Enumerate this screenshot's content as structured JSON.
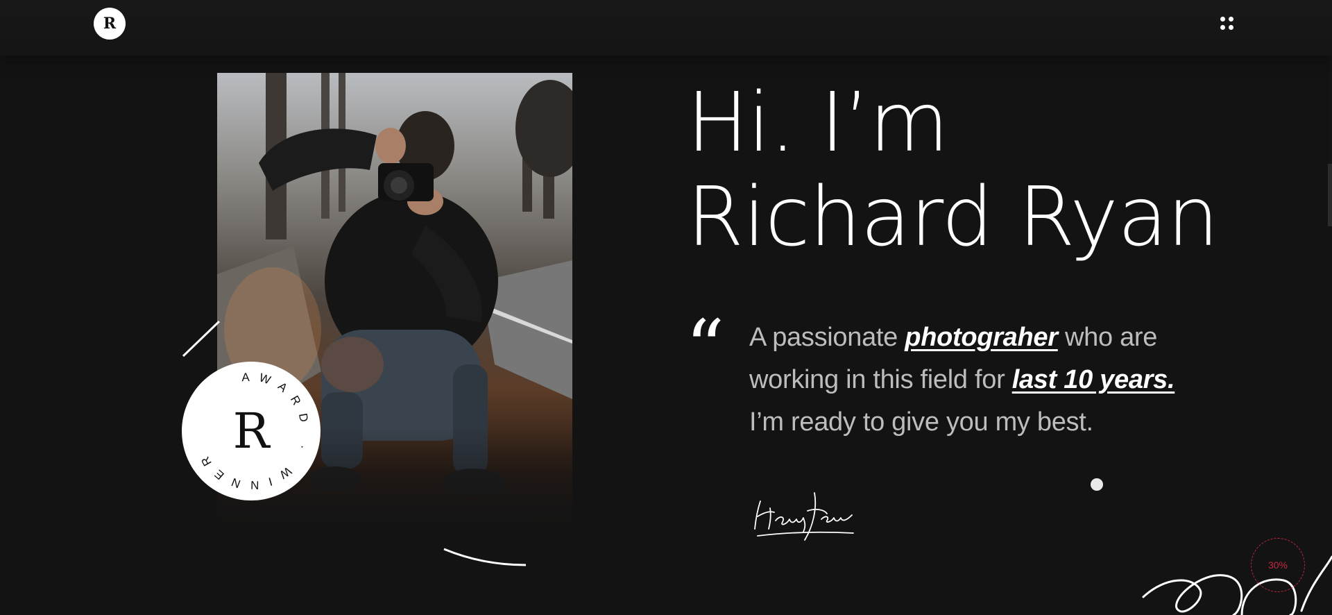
{
  "header": {
    "logo_letter": "R",
    "menu_icon": "dots-grid-icon"
  },
  "hero": {
    "heading_line1": "Hi. I’m",
    "heading_line2": "Richard Ryan",
    "quote_icon": "quote-icon",
    "intro": {
      "part1": "A passionate ",
      "highlight1": "photograher",
      "part2": " who are working in this field for ",
      "highlight2": "last 10 years.",
      "part3": " I’m ready to give you my best."
    },
    "signature_text": "Henry James"
  },
  "badge": {
    "letter": "R",
    "ring_text": "AWARD · WINNER ·"
  },
  "progress": {
    "label": "30%",
    "value": 0.3
  },
  "colors": {
    "background": "#131313",
    "accent": "#c4263f",
    "text_muted": "#bdbdbd"
  }
}
